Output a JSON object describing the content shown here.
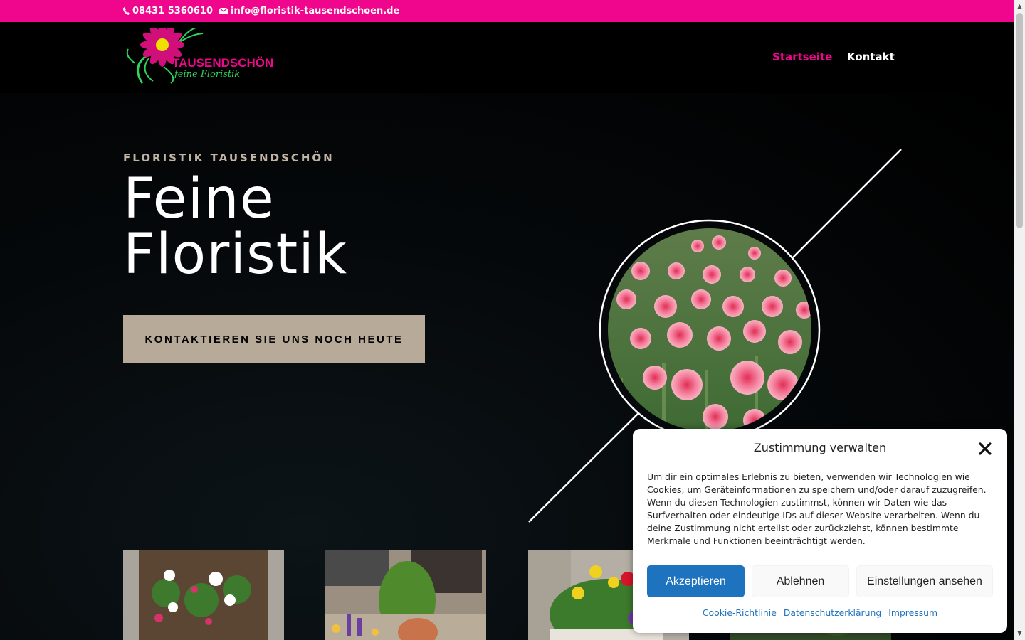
{
  "topbar": {
    "phone": "08431 5360610",
    "email": "info@floristik-tausendschoen.de",
    "background": "#f0068c"
  },
  "header": {
    "logo_text": "TAUSENDSCHÖN",
    "logo_subtext": "feine Floristik",
    "nav": [
      {
        "label": "Startseite",
        "active": true
      },
      {
        "label": "Kontakt",
        "active": false
      }
    ]
  },
  "hero": {
    "eyebrow": "FLORISTIK TAUSENDSCHÖN",
    "headline_line1": "Feine",
    "headline_line2": "Floristik",
    "cta_label": "KONTAKTIEREN SIE UNS NOCH HEUTE"
  },
  "cookie_modal": {
    "title": "Zustimmung verwalten",
    "body": "Um dir ein optimales Erlebnis zu bieten, verwenden wir Technologien wie Cookies, um Geräteinformationen zu speichern und/oder darauf zuzugreifen. Wenn du diesen Technologien zustimmst, können wir Daten wie das Surfverhalten oder eindeutige IDs auf dieser Website verarbeiten. Wenn du deine Zustimmung nicht erteilst oder zurückziehst, können bestimmte Merkmale und Funktionen beeinträchtigt werden.",
    "accept_label": "Akzeptieren",
    "deny_label": "Ablehnen",
    "prefs_label": "Einstellungen ansehen",
    "links": [
      "Cookie-Richtlinie",
      "Datenschutzerklärung",
      "Impressum"
    ]
  },
  "colors": {
    "accent": "#f0068c",
    "cta_bg": "#b8aa98",
    "accept_bg": "#1e73be"
  },
  "icons": [
    "phone-icon",
    "mail-icon",
    "close-icon"
  ]
}
